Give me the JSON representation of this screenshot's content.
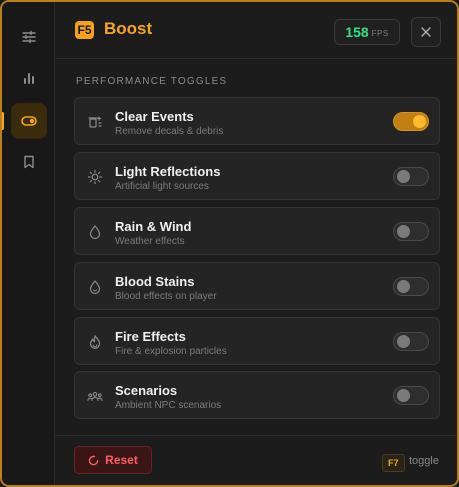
{
  "colors": {
    "accent": "#f5a623",
    "fps_green": "#2ee37f",
    "danger": "#ff5c5c"
  },
  "sidebar": {
    "items": [
      {
        "icon": "sliders-icon",
        "active": false
      },
      {
        "icon": "bar-chart-icon",
        "active": false
      },
      {
        "icon": "toggle-icon",
        "active": true
      },
      {
        "icon": "bookmark-icon",
        "active": false
      }
    ]
  },
  "header": {
    "logo": "F5",
    "title": "Boost",
    "fps_value": "158",
    "fps_unit": "FPS",
    "close_icon": "close-icon"
  },
  "section": {
    "title": "PERFORMANCE TOGGLES"
  },
  "toggles": [
    {
      "label": "Clear Events",
      "desc": "Remove decals & debris",
      "icon": "trash-sparkle-icon",
      "on": true
    },
    {
      "label": "Light Reflections",
      "desc": "Artificial light sources",
      "icon": "sun-icon",
      "on": false
    },
    {
      "label": "Rain & Wind",
      "desc": "Weather effects",
      "icon": "droplet-icon",
      "on": false
    },
    {
      "label": "Blood Stains",
      "desc": "Blood effects on player",
      "icon": "blood-drop-icon",
      "on": false
    },
    {
      "label": "Fire Effects",
      "desc": "Fire & explosion particles",
      "icon": "flame-icon",
      "on": false
    },
    {
      "label": "Scenarios",
      "desc": "Ambient NPC scenarios",
      "icon": "people-icon",
      "on": false
    }
  ],
  "footer": {
    "reset_label": "Reset",
    "hotkey": "F7",
    "hotkey_label": "toggle"
  }
}
